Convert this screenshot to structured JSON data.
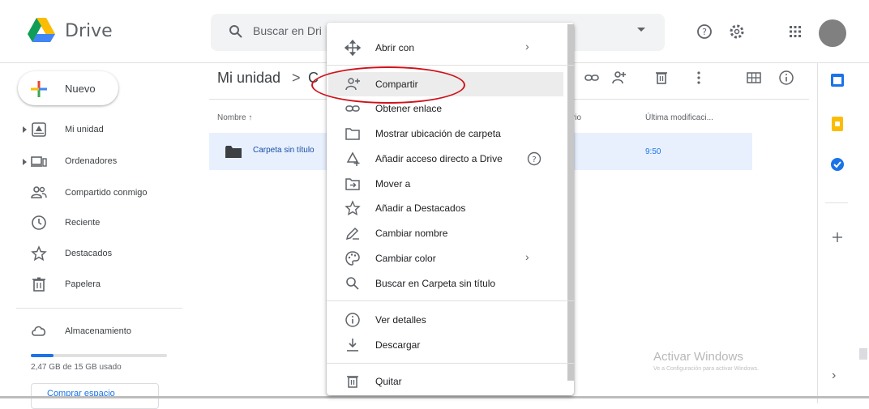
{
  "app": {
    "name": "Drive"
  },
  "search": {
    "placeholder": "Buscar en Drive",
    "value": "Buscar en Dri"
  },
  "top_icons": [
    "help-icon",
    "settings-icon",
    "apps-grid-icon"
  ],
  "sidebar": {
    "new_label": "Nuevo",
    "items": [
      {
        "label": "Mi unidad",
        "icon": "my-drive-icon",
        "expandable": true
      },
      {
        "label": "Ordenadores",
        "icon": "computers-icon",
        "expandable": true
      },
      {
        "label": "Compartido conmigo",
        "icon": "shared-icon",
        "expandable": false
      },
      {
        "label": "Reciente",
        "icon": "clock-icon",
        "expandable": false
      },
      {
        "label": "Destacados",
        "icon": "star-icon",
        "expandable": false
      },
      {
        "label": "Papelera",
        "icon": "trash-icon",
        "expandable": false
      }
    ],
    "storage_label": "Almacenamiento",
    "storage_used": "2,47 GB de 15 GB usado",
    "storage_fraction": 0.165,
    "buy_label": "Comprar espacio"
  },
  "breadcrumb": {
    "root": "Mi unidad",
    "separator": ">",
    "current": "C"
  },
  "columns": {
    "name": "Nombre",
    "owner": "rio",
    "modified": "Última modificaci..."
  },
  "files": [
    {
      "name": "Carpeta sin título",
      "modified": "9:50"
    }
  ],
  "context_menu": {
    "items": [
      {
        "label": "Abrir con",
        "icon": "open-with-icon",
        "submenu": true
      },
      {
        "label": "Compartir",
        "icon": "share-person-icon",
        "submenu": false,
        "highlighted": true
      },
      {
        "label": "Obtener enlace",
        "icon": "link-icon",
        "submenu": false
      },
      {
        "label": "Mostrar ubicación de carpeta",
        "icon": "folder-outline-icon",
        "submenu": false
      },
      {
        "label": "Añadir acceso directo a Drive",
        "icon": "add-shortcut-icon",
        "submenu": false,
        "help": true
      },
      {
        "label": "Mover a",
        "icon": "move-to-icon",
        "submenu": false
      },
      {
        "label": "Añadir a Destacados",
        "icon": "star-outline-icon",
        "submenu": false
      },
      {
        "label": "Cambiar nombre",
        "icon": "rename-pencil-icon",
        "submenu": false
      },
      {
        "label": "Cambiar color",
        "icon": "palette-icon",
        "submenu": true
      },
      {
        "label": "Buscar en Carpeta sin título",
        "icon": "search-icon",
        "submenu": false
      },
      {
        "label": "Ver detalles",
        "icon": "info-icon",
        "submenu": false
      },
      {
        "label": "Descargar",
        "icon": "download-icon",
        "submenu": false
      },
      {
        "label": "Quitar",
        "icon": "trash-icon",
        "submenu": false
      }
    ]
  },
  "watermark": {
    "title": "Activar Windows",
    "subtitle": "Ve a Configuración para activar Windows."
  },
  "colors": {
    "accent": "#1a73e8",
    "highlight_ring": "#d0121b",
    "selected_row": "#e8f0fe"
  }
}
